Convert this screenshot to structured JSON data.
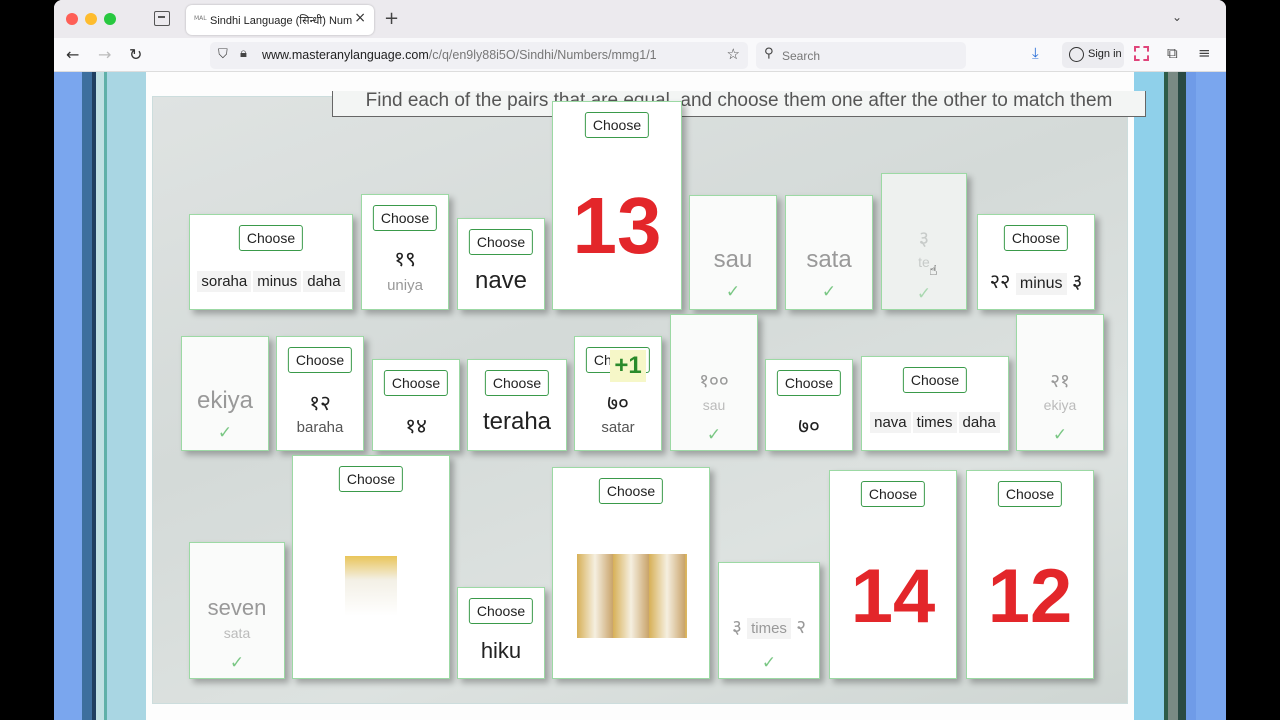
{
  "browser": {
    "tab_title": "Sindhi Language (सिन्धी) Number",
    "tab_favicon": "MAL",
    "url_host": "www.masteranylanguage.com",
    "url_path": "/c/q/en9ly88i5O/Sindhi/Numbers/mmg1/1",
    "search_placeholder": "Search",
    "signin_label": "Sign in"
  },
  "game": {
    "instruction": "Find each of the pairs that are equal, and choose them one after the other to match them",
    "choose_label": "Choose",
    "bonus": "+1",
    "check_mark": "✓",
    "cards": {
      "c13": {
        "big": "13"
      },
      "sau": {
        "word": "sau"
      },
      "sata": {
        "word": "sata"
      },
      "te": {
        "numeral": "३",
        "word": "te"
      },
      "minus22_3": {
        "left": "२२",
        "op": "minus",
        "right": "३"
      },
      "soraha": {
        "a": "soraha",
        "op": "minus",
        "b": "daha"
      },
      "uniya": {
        "numeral": "१९",
        "word": "uniya"
      },
      "nave": {
        "word": "nave"
      },
      "ekiya": {
        "word": "ekiya"
      },
      "baraha": {
        "numeral": "१२",
        "word": "baraha"
      },
      "n14": {
        "numeral": "१४"
      },
      "teraha": {
        "word": "teraha"
      },
      "satar": {
        "numeral": "७०",
        "word": "satar"
      },
      "sau100": {
        "numeral": "१००",
        "word": "sau"
      },
      "n70": {
        "numeral": "७०"
      },
      "navatimes": {
        "a": "nava",
        "op": "times",
        "b": "daha"
      },
      "ekiya21": {
        "numeral": "२१",
        "word": "ekiya"
      },
      "seven": {
        "word": "seven",
        "sub": "sata"
      },
      "hiku": {
        "word": "hiku"
      },
      "times3_2": {
        "left": "३",
        "op": "times",
        "right": "२"
      },
      "c14": {
        "big": "14"
      },
      "c12": {
        "big": "12"
      }
    }
  }
}
